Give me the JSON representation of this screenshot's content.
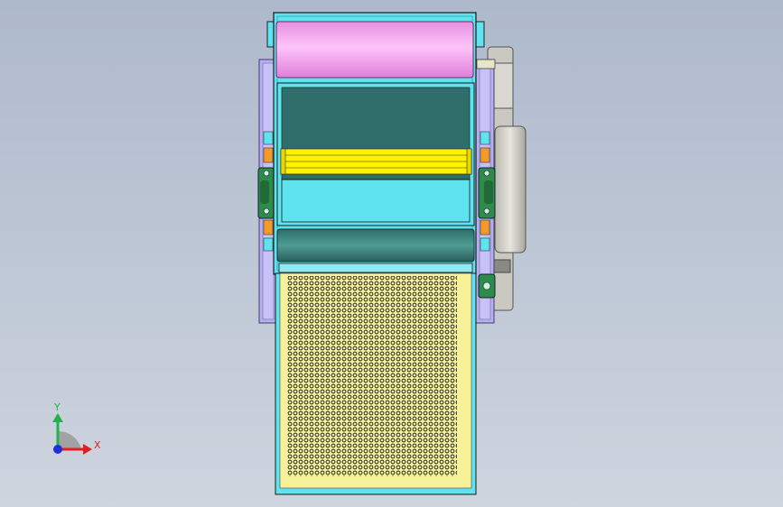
{
  "view": {
    "background_top": "#aeb9cb",
    "background_bottom": "#cfd5df"
  },
  "model": {
    "colors": {
      "frame": "#5fe3ee",
      "side_plate": "#b8aef0",
      "top_roller": "#f7a8f2",
      "hopper_dark": "#2f6e6b",
      "hopper_light": "#5fe3ee",
      "blade": "#fff200",
      "bottom_roller": "#3f8c86",
      "bearing": "#2e8b4a",
      "orange_block": "#f39a2a",
      "pulley": "#d8d8d0",
      "screen": "#f7f29a",
      "holes": "#2a2a2a"
    }
  },
  "triad": {
    "x_label": "X",
    "y_label": "Y",
    "x_color": "#e02020",
    "y_color": "#22b14c",
    "z_color": "#1d2fd8"
  }
}
